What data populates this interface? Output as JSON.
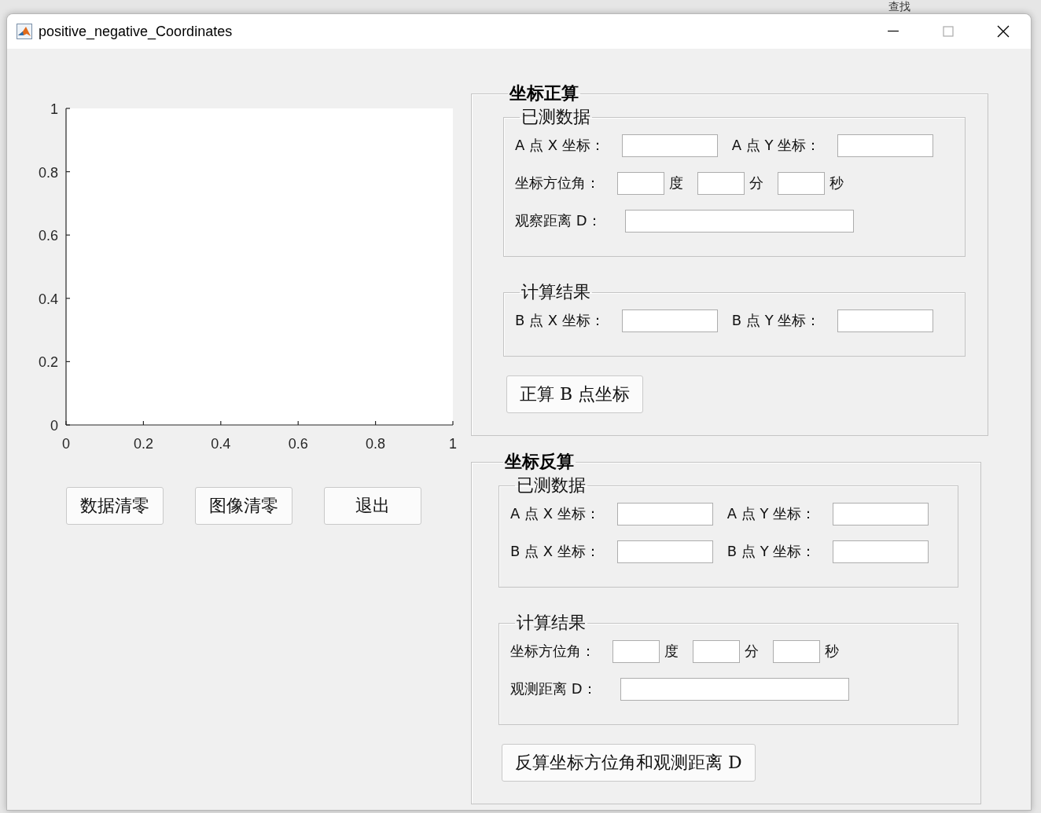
{
  "background": {
    "search_label": "查找"
  },
  "window": {
    "title": "positive_negative_Coordinates"
  },
  "plot": {
    "chart_data": {
      "type": "line",
      "xlim": [
        0,
        1
      ],
      "ylim": [
        0,
        1
      ],
      "xticks": [
        0,
        0.2,
        0.4,
        0.6,
        0.8,
        1
      ],
      "yticks": [
        0,
        0.2,
        0.4,
        0.6,
        0.8,
        1
      ]
    }
  },
  "buttons": [
    "数据清零",
    "图像清零",
    "退出"
  ],
  "panels": [
    {
      "title": "坐标正算",
      "groups": [
        {
          "title": "已测数据",
          "rows": [
            {
              "kind": "xy",
              "x_label": "A 点 X 坐标：",
              "y_label": "A 点 Y 坐标："
            },
            {
              "kind": "angle",
              "label": "坐标方位角：",
              "units": [
                "度",
                "分",
                "秒"
              ]
            },
            {
              "kind": "distance",
              "label": "观察距离 D："
            }
          ]
        },
        {
          "title": "计算结果",
          "rows": [
            {
              "kind": "xy",
              "x_label": "B 点 X 坐标：",
              "y_label": "B 点 Y 坐标："
            }
          ]
        }
      ],
      "button": "正算 B 点坐标"
    },
    {
      "title": "坐标反算",
      "groups": [
        {
          "title": "已测数据",
          "rows": [
            {
              "kind": "xy",
              "x_label": "A 点 X 坐标：",
              "y_label": "A 点 Y 坐标："
            },
            {
              "kind": "xy",
              "x_label": "B 点 X 坐标：",
              "y_label": "B 点 Y 坐标："
            }
          ]
        },
        {
          "title": "计算结果",
          "rows": [
            {
              "kind": "angle",
              "label": "坐标方位角：",
              "units": [
                "度",
                "分",
                "秒"
              ]
            },
            {
              "kind": "distance",
              "label": "观测距离 D："
            }
          ]
        }
      ],
      "button": "反算坐标方位角和观测距离 D"
    }
  ]
}
